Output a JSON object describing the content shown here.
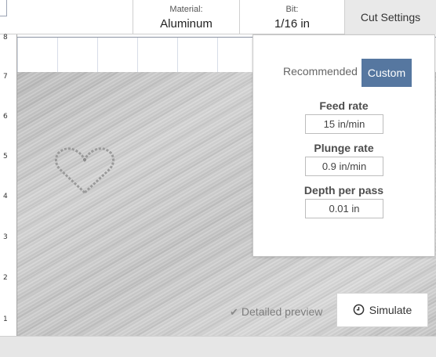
{
  "topbar": {
    "material": {
      "label": "Material:",
      "value": "Aluminum"
    },
    "bit": {
      "label": "Bit:",
      "value": "1/16 in"
    },
    "cut_settings_label": "Cut Settings"
  },
  "axis": {
    "y_ticks": [
      "8",
      "7",
      "6",
      "5",
      "4",
      "3",
      "2",
      "1"
    ]
  },
  "panel": {
    "recommended_label": "Recommended",
    "custom_label": "Custom",
    "feed_rate": {
      "label": "Feed rate",
      "value": "15 in/min"
    },
    "plunge_rate": {
      "label": "Plunge rate",
      "value": "0.9 in/min"
    },
    "depth_per_pass": {
      "label": "Depth per pass",
      "value": "0.01 in"
    }
  },
  "preview": {
    "detailed_label": "Detailed preview"
  },
  "simulate": {
    "label": "Simulate"
  },
  "icons": {
    "check": "check-icon",
    "clock": "clock-icon",
    "heart": "heart-shape"
  },
  "colors": {
    "accent": "#5677a0"
  }
}
